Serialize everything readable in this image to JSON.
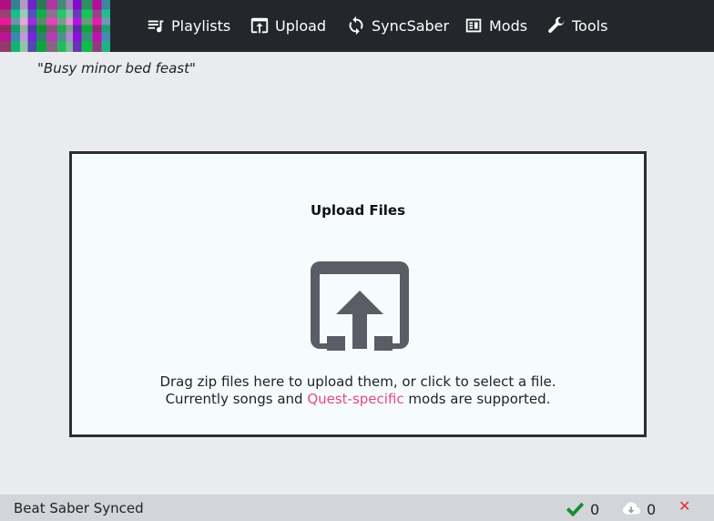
{
  "nav": {
    "items": [
      {
        "label": "Playlists",
        "icon": "playlist-icon"
      },
      {
        "label": "Upload",
        "icon": "upload-icon"
      },
      {
        "label": "SyncSaber",
        "icon": "sync-icon"
      },
      {
        "label": "Mods",
        "icon": "mods-icon"
      },
      {
        "label": "Tools",
        "icon": "wrench-icon"
      }
    ]
  },
  "quote": "\"Busy minor bed feast\"",
  "dropzone": {
    "title": "Upload Files",
    "line1": "Drag zip files here to upload them, or click to select a file.",
    "line2_before": "Currently songs and ",
    "line2_link": "Quest-specific",
    "line2_after": " mods are supported.",
    "link_color": "#e8497d",
    "icon": "upload-box-icon"
  },
  "status": {
    "title": "Beat Saber Synced",
    "ok_count": "0",
    "download_count": "0",
    "close": "✕"
  },
  "colors": {
    "topbar": "#23272c",
    "background": "#e9ebee",
    "dropzone_bg": "#f6fcfe",
    "statusbar": "#d2d6da",
    "check": "#1d8a2e",
    "close": "#e0302e"
  }
}
